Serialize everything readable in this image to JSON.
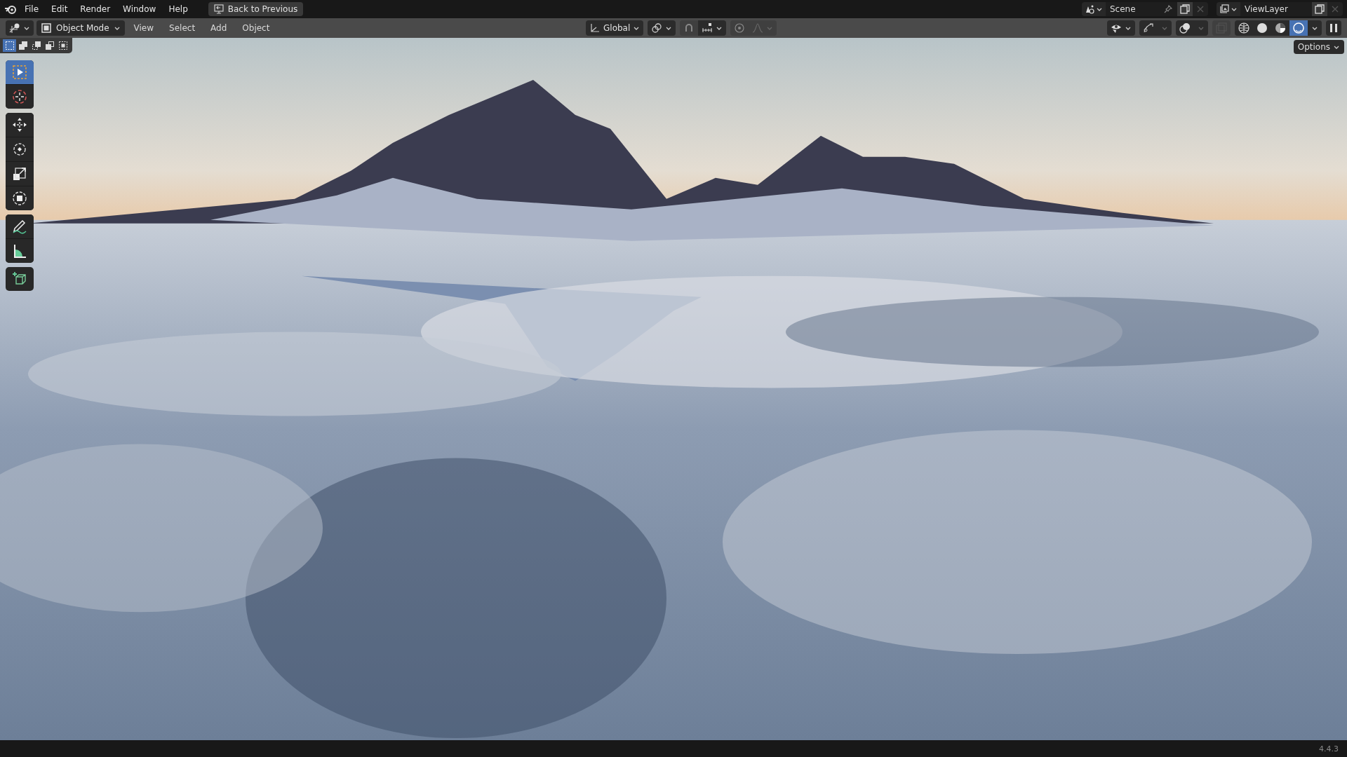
{
  "top_bar": {
    "menus": [
      "File",
      "Edit",
      "Render",
      "Window",
      "Help"
    ],
    "back_button": "Back to Previous",
    "scene": "Scene",
    "view_layer": "ViewLayer"
  },
  "header": {
    "mode": "Object Mode",
    "menus": [
      "View",
      "Select",
      "Add",
      "Object"
    ],
    "orientation": "Global",
    "shading": [
      {
        "kind": "wireframe",
        "selected": false
      },
      {
        "kind": "solid",
        "selected": false
      },
      {
        "kind": "material",
        "selected": false
      },
      {
        "kind": "rendered",
        "selected": true
      }
    ]
  },
  "select_modes": [
    {
      "kind": "new",
      "selected": true
    },
    {
      "kind": "extend",
      "selected": false
    },
    {
      "kind": "subtract",
      "selected": false
    },
    {
      "kind": "invert",
      "selected": false
    },
    {
      "kind": "intersect",
      "selected": false
    }
  ],
  "options_button": "Options",
  "tool_groups": [
    [
      {
        "kind": "select",
        "selected": true
      },
      {
        "kind": "cursor",
        "selected": false
      }
    ],
    [
      {
        "kind": "move",
        "selected": false
      },
      {
        "kind": "rotate",
        "selected": false
      },
      {
        "kind": "scale",
        "selected": false
      },
      {
        "kind": "transform",
        "selected": false
      }
    ],
    [
      {
        "kind": "annotate",
        "selected": false
      },
      {
        "kind": "measure",
        "selected": false
      }
    ],
    [
      {
        "kind": "add-cube",
        "selected": false
      }
    ]
  ],
  "status_bar": {
    "version": "4.4.3"
  }
}
